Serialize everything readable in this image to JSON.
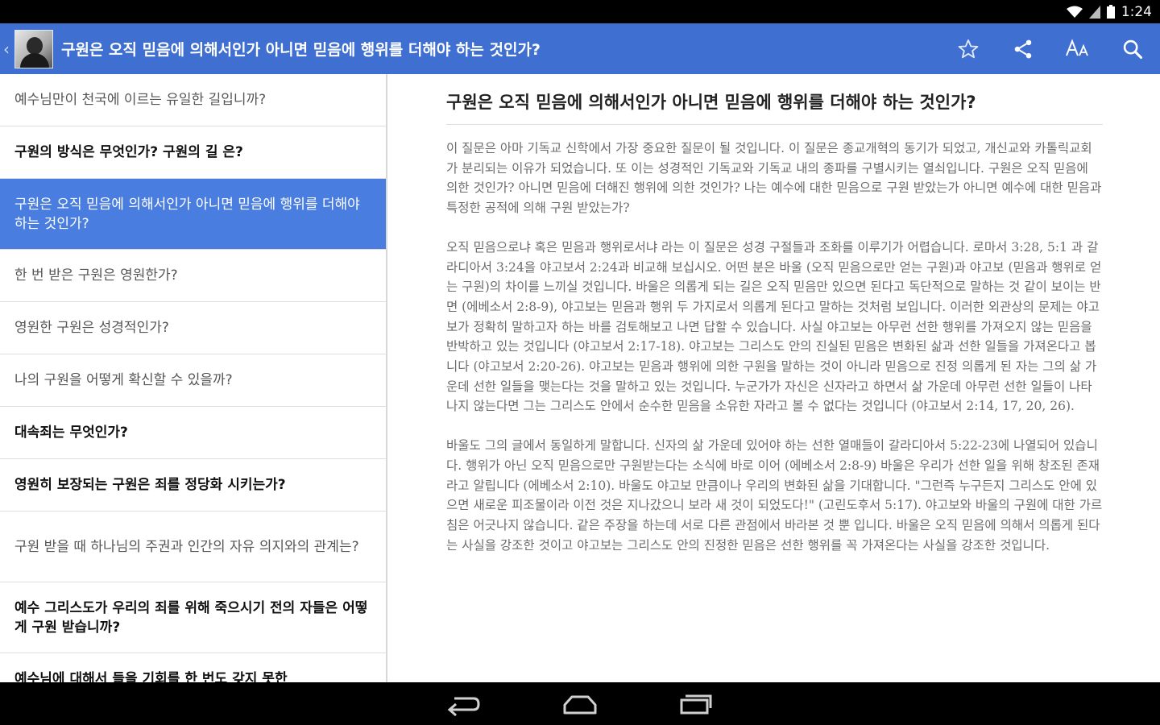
{
  "statusbar": {
    "time": "1:24"
  },
  "appbar": {
    "title": "구원은 오직 믿음에 의해서인가 아니면 믿음에 행위를 더해야 하는 것인가?"
  },
  "sidebar": {
    "items": [
      {
        "label": "예수님만이 천국에 이르는 유일한 길입니까?",
        "style": "normal"
      },
      {
        "label": "구원의 방식은 무엇인가? 구원의 길 은?",
        "style": "bold"
      },
      {
        "label": "구원은 오직 믿음에 의해서인가 아니면 믿음에 행위를 더해야 하는 것인가?",
        "style": "active"
      },
      {
        "label": "한 번 받은 구원은 영원한가?",
        "style": "normal"
      },
      {
        "label": "영원한 구원은 성경적인가?",
        "style": "normal"
      },
      {
        "label": "나의 구원을 어떻게 확신할 수 있을까?",
        "style": "normal"
      },
      {
        "label": "대속죄는 무엇인가?",
        "style": "bold"
      },
      {
        "label": "영원히 보장되는 구원은 죄를 정당화 시키는가?",
        "style": "bold"
      },
      {
        "label": "구원 받을 때 하나님의 주권과 인간의 자유 의지와의 관계는?",
        "style": "normal"
      },
      {
        "label": "예수 그리스도가 우리의 죄를 위해 죽으시기 전의 자들은 어떻게 구원 받습니까?",
        "style": "bold"
      },
      {
        "label": "예수님에 대해서 들을 기회를 한 번도 갖지 못한",
        "style": "bold"
      }
    ]
  },
  "article": {
    "title": "구원은 오직 믿음에 의해서인가 아니면 믿음에 행위를 더해야 하는 것인가?",
    "paragraphs": [
      "이 질문은 아마 기독교 신학에서 가장 중요한 질문이 될 것입니다. 이 질문은 종교개혁의 동기가 되었고, 개신교와 카톨릭교회가 분리되는 이유가 되었습니다. 또 이는 성경적인 기독교와 기독교 내의 종파를 구별시키는 열쇠입니다. 구원은 오직 믿음에 의한 것인가? 아니면 믿음에 더해진 행위에 의한 것인가? 나는 예수에 대한 믿음으로 구원 받았는가 아니면 예수에 대한 믿음과 특정한 공적에 의해 구원 받았는가?",
      "오직 믿음으로냐 혹은 믿음과 행위로서냐 라는 이 질문은 성경 구절들과 조화를 이루기가 어렵습니다. 로마서 3:28, 5:1 과 갈라디아서 3:24을 야고보서 2:24과 비교해 보십시오. 어떤 분은 바울 (오직 믿음으로만 얻는 구원)과 야고보 (믿음과 행위로 얻는 구원)의 차이를 느끼실 것입니다. 바울은 의롭게 되는 길은 오직 믿음만 있으면 된다고 독단적으로 말하는 것 같이 보이는 반면 (에베소서 2:8-9), 야고보는 믿음과 행위 두 가지로서 의롭게 된다고 말하는 것처럼 보입니다. 이러한 외관상의 문제는 야고보가 정확히 말하고자 하는 바를 검토해보고 나면 답할 수 있습니다. 사실 야고보는 아무런 선한 행위를 가져오지 않는 믿음을 반박하고 있는 것입니다 (야고보서 2:17-18). 야고보는 그리스도 안의 진실된 믿음은 변화된 삶과 선한 일들을 가져온다고 봅니다 (야고보서 2:20-26). 야고보는 믿음과 행위에 의한 구원을 말하는 것이 아니라 믿음으로 진정 의롭게 된 자는 그의 삶 가운데 선한 일들을 맺는다는 것을 말하고 있는 것입니다. 누군가가 자신은 신자라고 하면서 삶 가운데 아무런 선한 일들이 나타나지 않는다면 그는 그리스도 안에서 순수한 믿음을 소유한 자라고 볼 수 없다는 것입니다 (야고보서 2:14, 17, 20, 26).",
      "바울도 그의 글에서 동일하게 말합니다. 신자의 삶 가운데 있어야 하는 선한 열매들이 갈라디아서 5:22-23에 나열되어 있습니다. 행위가 아닌 오직 믿음으로만 구원받는다는 소식에 바로 이어 (에베소서 2:8-9) 바울은 우리가 선한 일을 위해 창조된 존재라고 알립니다 (에베소서 2:10). 바울도 야고보 만큼이나 우리의 변화된 삶을 기대합니다. \"그런즉 누구든지 그리스도 안에 있으면 새로운 피조물이라 이전 것은 지나갔으니 보라 새 것이 되었도다!\" (고린도후서 5:17). 야고보와 바울의 구원에 대한 가르침은 어긋나지 않습니다. 같은 주장을 하는데 서로 다른 관점에서 바라본 것 뿐 입니다. 바울은 오직 믿음에 의해서 의롭게 된다는 사실을 강조한 것이고 야고보는 그리스도 안의 진정한 믿음은 선한 행위를 꼭 가져온다는 사실을 강조한 것입니다."
    ]
  },
  "icons": {
    "status": [
      "wifi-icon",
      "signal-icon",
      "battery-icon"
    ],
    "appbar": [
      "back-chevron-icon",
      "star-icon",
      "share-icon",
      "font-size-icon",
      "search-icon"
    ],
    "navbar": [
      "back-icon",
      "home-icon",
      "recents-icon"
    ]
  },
  "colors": {
    "appbar": "#3f6fd1",
    "active_item": "#4a7de0",
    "statusbar": "#000000",
    "navbar": "#000000"
  }
}
